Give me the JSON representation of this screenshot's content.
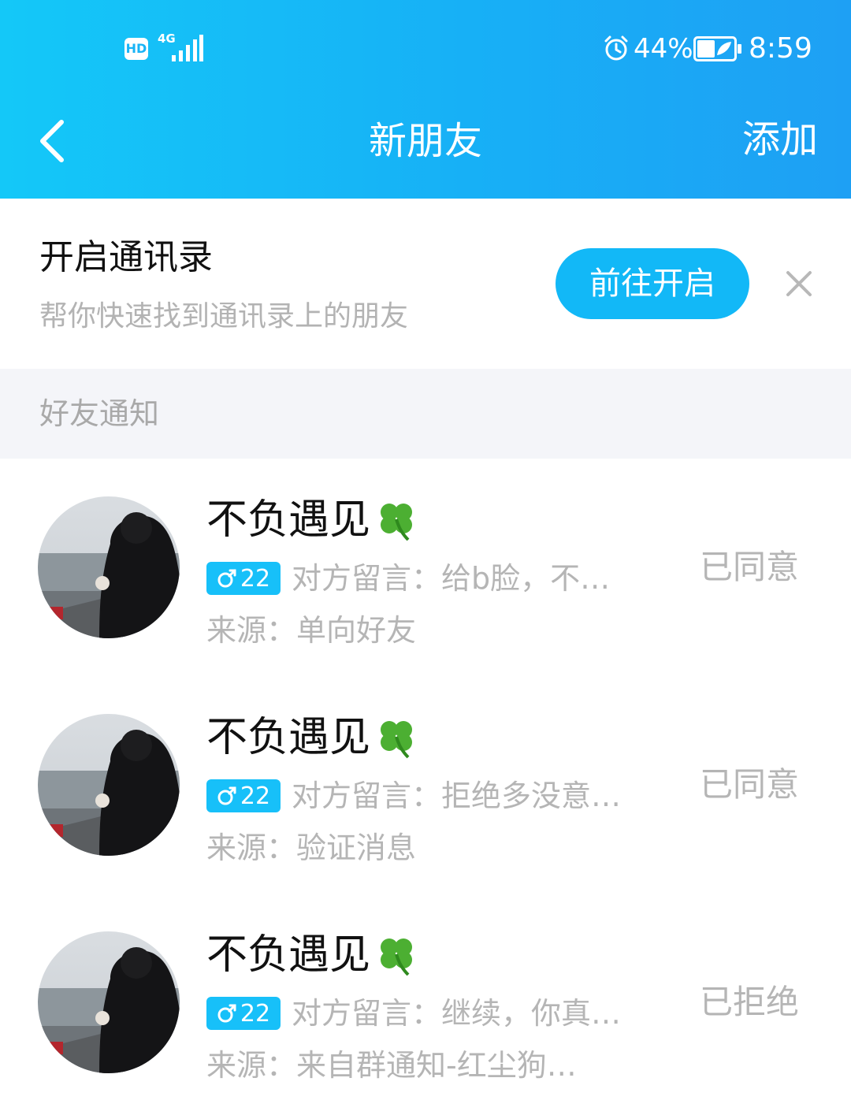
{
  "status_bar": {
    "hd": "HD",
    "network": "4G",
    "battery_percent": "44%",
    "time": "8:59"
  },
  "nav": {
    "title": "新朋友",
    "add_label": "添加"
  },
  "contacts_banner": {
    "title": "开启通讯录",
    "subtitle": "帮你快速找到通讯录上的朋友",
    "button_label": "前往开启"
  },
  "section": {
    "label": "好友通知"
  },
  "notifications": [
    {
      "name": "不负遇见",
      "age": "22",
      "message": "对方留言：给b脸，不…",
      "source": "来源：单向好友",
      "status": "已同意"
    },
    {
      "name": "不负遇见",
      "age": "22",
      "message": "对方留言：拒绝多没意…",
      "source": "来源：验证消息",
      "status": "已同意"
    },
    {
      "name": "不负遇见",
      "age": "22",
      "message": "对方留言：继续，你真…",
      "source": "来源：来自群通知-红尘狗…",
      "status": "已拒绝"
    }
  ],
  "icons": {
    "back": "chevron-left-icon",
    "close": "close-icon",
    "clover": "four-leaf-clover-icon",
    "gender": "male-icon",
    "alarm": "alarm-icon",
    "battery": "battery-icon",
    "signal": "signal-icon"
  },
  "colors": {
    "header_start": "#14c8f8",
    "header_end": "#1ea0f4",
    "button": "#12b8f7",
    "badge": "#17c0f9",
    "section_bg": "#f4f5f9",
    "muted_text": "#b5b5b5"
  }
}
